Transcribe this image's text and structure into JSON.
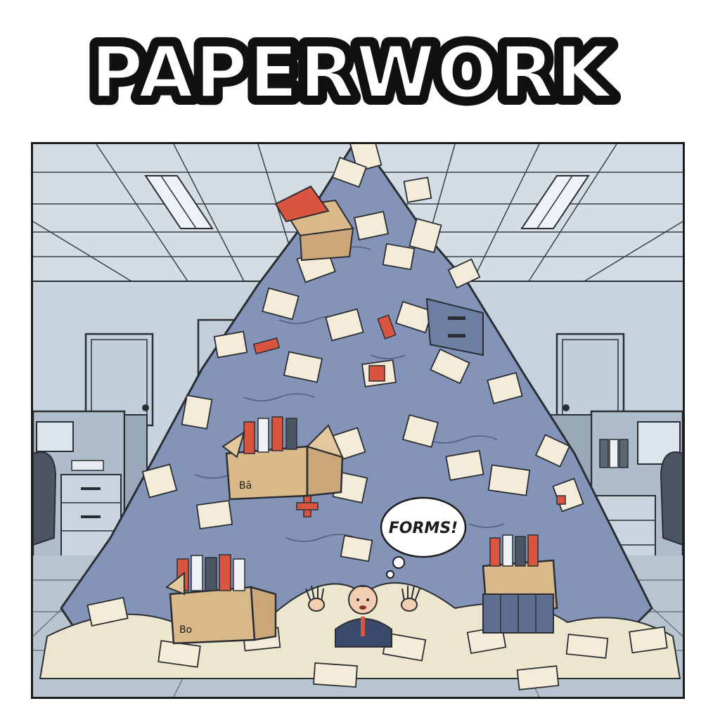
{
  "comic": {
    "title": "PAPERWORK",
    "speech_bubble": "FORMS!",
    "box_label_left": "Bo",
    "box_label_center": "Bā",
    "colors": {
      "title_fill": "#ffffff",
      "title_outline": "#111111",
      "wall": "#c7d3dd",
      "ceiling": "#d5dde4",
      "floor": "#b8c5d0",
      "pile": "#8494b8",
      "paper": "#f4ecd8",
      "cardboard": "#d9b88a",
      "accent_red": "#d9553f",
      "ink": "#1c1c1c"
    }
  }
}
